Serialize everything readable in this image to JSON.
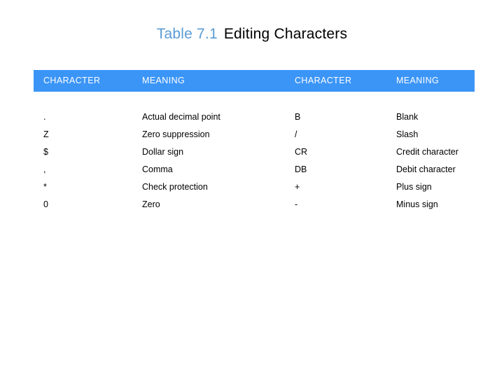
{
  "title": {
    "accent": "Table 7.1",
    "main": "Editing Characters",
    "accent_color": "#5B9BD5",
    "main_color": "#000000"
  },
  "table": {
    "header_bg": "#3B95F7",
    "header_text_color": "#FFFFFF",
    "columns": [
      "CHARACTER",
      "MEANING",
      "CHARACTER",
      "MEANING"
    ],
    "rows": [
      {
        "character_left": ".",
        "meaning_left": "Actual decimal point",
        "character_right": "B",
        "meaning_right": "Blank"
      },
      {
        "character_left": "Z",
        "meaning_left": "Zero suppression",
        "character_right": "/",
        "meaning_right": "Slash"
      },
      {
        "character_left": "$",
        "meaning_left": "Dollar sign",
        "character_right": "CR",
        "meaning_right": "Credit character"
      },
      {
        "character_left": ",",
        "meaning_left": "Comma",
        "character_right": "DB",
        "meaning_right": "Debit character"
      },
      {
        "character_left": "*",
        "meaning_left": "Check protection",
        "character_right": "+",
        "meaning_right": "Plus sign"
      },
      {
        "character_left": "0",
        "meaning_left": "Zero",
        "character_right": "-",
        "meaning_right": "Minus sign"
      }
    ]
  }
}
